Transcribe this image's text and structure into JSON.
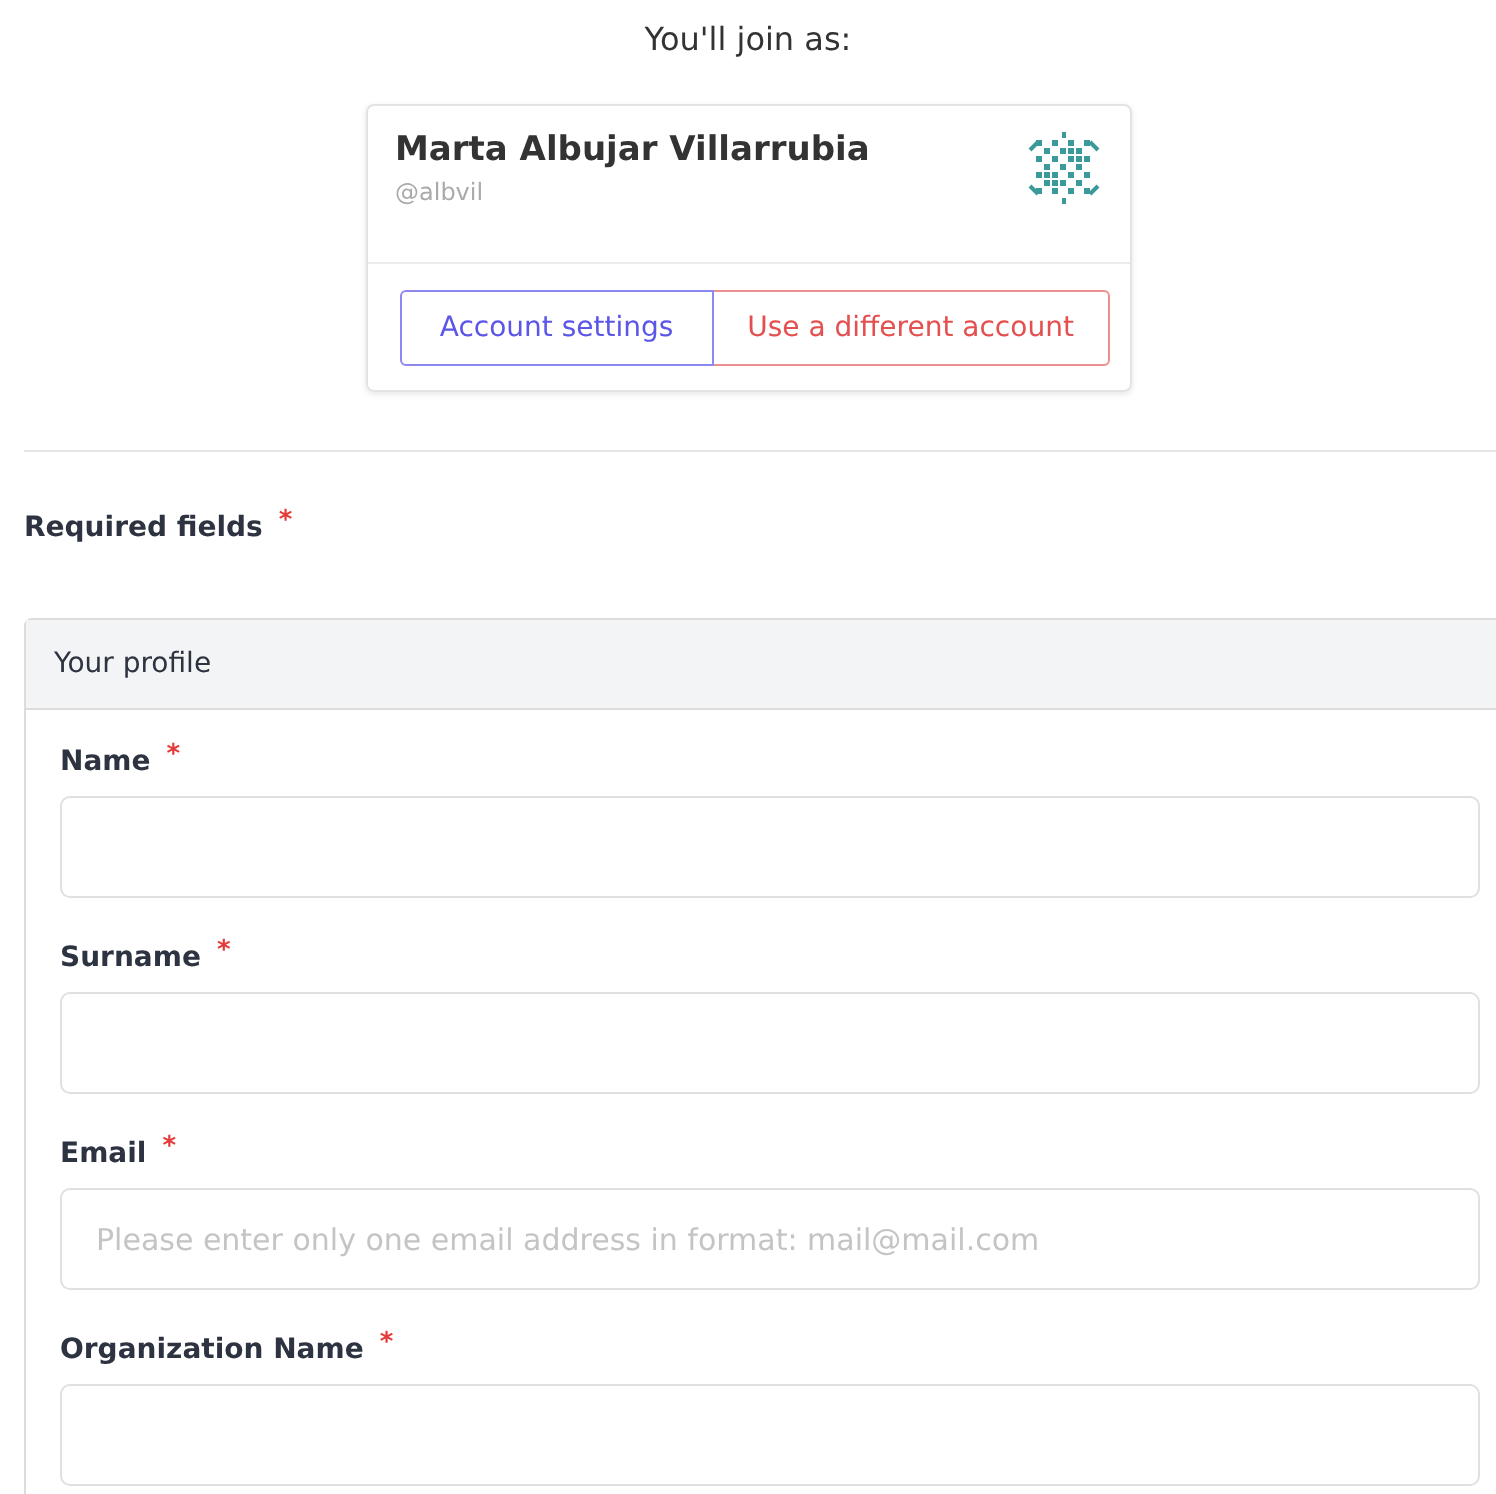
{
  "heading": "You'll join as:",
  "account": {
    "name": "Marta Albujar Villarrubia",
    "handle": "@albvil",
    "buttons": [
      {
        "label": "Account settings",
        "kind": "primary"
      },
      {
        "label": "Use a different account",
        "kind": "danger"
      }
    ]
  },
  "required_note": {
    "label": "Required fields",
    "marker": "*"
  },
  "panel": {
    "title": "Your profile",
    "fields": [
      {
        "label": "Name",
        "marker": "*"
      },
      {
        "label": "Surname",
        "marker": "*"
      },
      {
        "label": "Email",
        "marker": "*",
        "placeholder": "Please enter only one email address in format: mail@mail.com"
      },
      {
        "label": "Organization Name",
        "marker": "*"
      }
    ]
  }
}
